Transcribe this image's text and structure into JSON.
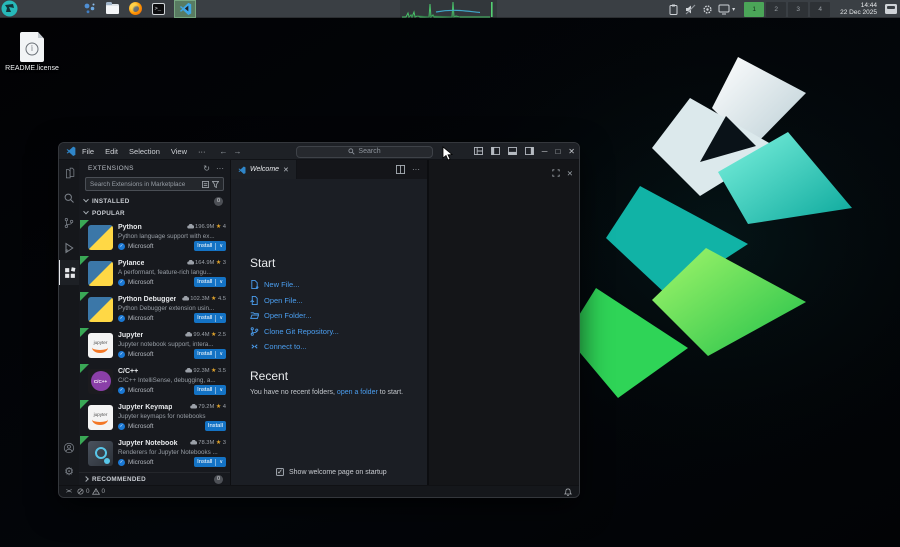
{
  "taskbar": {
    "clock_time": "14:44",
    "clock_date": "22 Dec 2025",
    "desktops": [
      {
        "label": "1",
        "active": true
      },
      {
        "label": "2",
        "active": false
      },
      {
        "label": "3",
        "active": false
      },
      {
        "label": "4",
        "active": false
      }
    ]
  },
  "desktop": {
    "readme_label": "README.license"
  },
  "vscode": {
    "titlebar": {
      "menus": [
        "File",
        "Edit",
        "Selection",
        "View",
        "···"
      ],
      "search_placeholder": "Search"
    },
    "sidebar": {
      "title": "EXTENSIONS",
      "search_placeholder": "Search Extensions in Marketplace",
      "installed_label": "INSTALLED",
      "installed_badge": "0",
      "popular_label": "POPULAR",
      "recommended_label": "RECOMMENDED",
      "recommended_badge": "0",
      "extensions": [
        {
          "name": "Python",
          "downloads": "196.9M",
          "rating": "4",
          "description": "Python language support with ex...",
          "publisher": "Microsoft",
          "install_label": "Install",
          "has_dropdown": true,
          "icon": "python"
        },
        {
          "name": "Pylance",
          "downloads": "164.9M",
          "rating": "3",
          "description": "A performant, feature-rich langu...",
          "publisher": "Microsoft",
          "install_label": "Install",
          "has_dropdown": true,
          "icon": "python"
        },
        {
          "name": "Python Debugger",
          "downloads": "102.3M",
          "rating": "4.5",
          "description": "Python Debugger extension usin...",
          "publisher": "Microsoft",
          "install_label": "Install",
          "has_dropdown": true,
          "icon": "python"
        },
        {
          "name": "Jupyter",
          "downloads": "99.4M",
          "rating": "2.5",
          "description": "Jupyter notebook support, intera...",
          "publisher": "Microsoft",
          "install_label": "Install",
          "has_dropdown": true,
          "icon": "jupyter"
        },
        {
          "name": "C/C++",
          "downloads": "92.3M",
          "rating": "3.5",
          "description": "C/C++ IntelliSense, debugging, a...",
          "publisher": "Microsoft",
          "install_label": "Install",
          "has_dropdown": true,
          "icon": "cpp"
        },
        {
          "name": "Jupyter Keymap",
          "downloads": "79.2M",
          "rating": "4",
          "description": "Jupyter keymaps for notebooks",
          "publisher": "Microsoft",
          "install_label": "Install",
          "has_dropdown": false,
          "icon": "jupyter"
        },
        {
          "name": "Jupyter Notebook ...",
          "downloads": "78.3M",
          "rating": "3",
          "description": "Renderers for Jupyter Notebooks ...",
          "publisher": "Microsoft",
          "install_label": "Install",
          "has_dropdown": true,
          "icon": "notebook"
        }
      ]
    },
    "editor": {
      "tab_label": "Welcome",
      "start_title": "Start",
      "start_links": [
        {
          "label": "New File...",
          "icon": "new-file"
        },
        {
          "label": "Open File...",
          "icon": "open-file"
        },
        {
          "label": "Open Folder...",
          "icon": "open-folder"
        },
        {
          "label": "Clone Git Repository...",
          "icon": "git-branch"
        },
        {
          "label": "Connect to...",
          "icon": "remote"
        }
      ],
      "recent_title": "Recent",
      "recent_text_pre": "You have no recent folders,",
      "recent_link_label": "open a folder",
      "recent_text_post": "to start.",
      "startup_checkbox_label": "Show welcome page on startup"
    },
    "statusbar": {
      "errors": "0",
      "warnings": "0"
    }
  },
  "colors": {
    "accent_blue": "#4b9eef",
    "install_blue": "#1473c5",
    "star_orange": "#e2a42b",
    "active_desktop_green": "#4ba558",
    "ribbon_green": "#3aa856"
  }
}
